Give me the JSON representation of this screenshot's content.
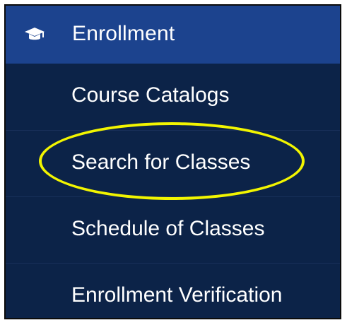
{
  "header": {
    "title": "Enrollment",
    "icon": "graduation-cap-icon"
  },
  "menu": {
    "items": [
      {
        "label": "Course Catalogs"
      },
      {
        "label": "Search for Classes"
      },
      {
        "label": "Schedule of Classes"
      },
      {
        "label": "Enrollment Verification"
      }
    ]
  },
  "colors": {
    "header_bg": "#1c438e",
    "menu_bg": "#0c2348",
    "text": "#ffffff",
    "highlight": "#f2f500"
  }
}
